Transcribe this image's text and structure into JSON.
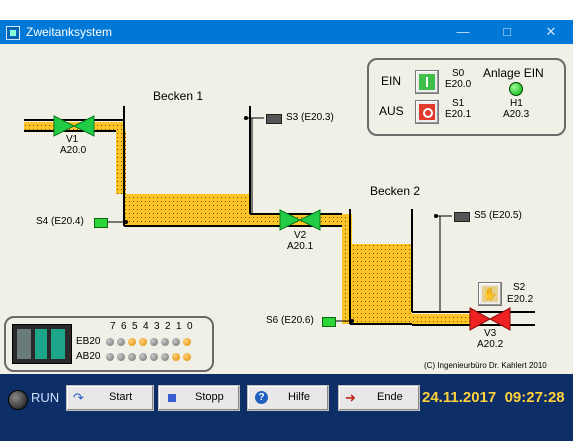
{
  "window": {
    "title": "Zweitanksystem"
  },
  "tanks": {
    "tank1": "Becken 1",
    "tank2": "Becken 2"
  },
  "valves": [
    {
      "name": "V1",
      "addr": "A20.0",
      "state": "open"
    },
    {
      "name": "V2",
      "addr": "A20.1",
      "state": "open"
    },
    {
      "name": "V3",
      "addr": "A20.2",
      "state": "closed"
    }
  ],
  "sensors": {
    "s3": "S3 (E20.3)",
    "s4": "S4 (E20.4)",
    "s5": "S5 (E20.5)",
    "s6": "S6 (E20.6)"
  },
  "controls": {
    "ein_label": "EIN",
    "aus_label": "AUS",
    "s0_name": "S0",
    "s0_addr": "E20.0",
    "s1_name": "S1",
    "s1_addr": "E20.1",
    "anlage_label": "Anlage EIN",
    "h1_name": "H1",
    "h1_addr": "A20.3",
    "s2_name": "S2",
    "s2_addr": "E20.2"
  },
  "plc": {
    "bit_labels": [
      "7",
      "6",
      "5",
      "4",
      "3",
      "2",
      "1",
      "0"
    ],
    "eb_label": "EB20",
    "ab_label": "AB20",
    "eb_bits": [
      0,
      0,
      1,
      1,
      0,
      0,
      0,
      1
    ],
    "ab_bits": [
      0,
      0,
      0,
      0,
      0,
      0,
      1,
      1
    ]
  },
  "copyright": "(C) Ingenieurbüro Dr. Kahlert 2010",
  "footer": {
    "run_label": "RUN",
    "start": "Start",
    "stop": "Stopp",
    "help": "Hilfe",
    "end": "Ende",
    "date": "24.11.2017",
    "time": "09:27:28"
  },
  "colors": {
    "fluid": "#ffc425",
    "valve_open": "#22cc44",
    "valve_closed": "#ee2222",
    "background": "#f0f0e6",
    "footer_bg": "#0d2e67",
    "datetime": "#ffd23c"
  }
}
